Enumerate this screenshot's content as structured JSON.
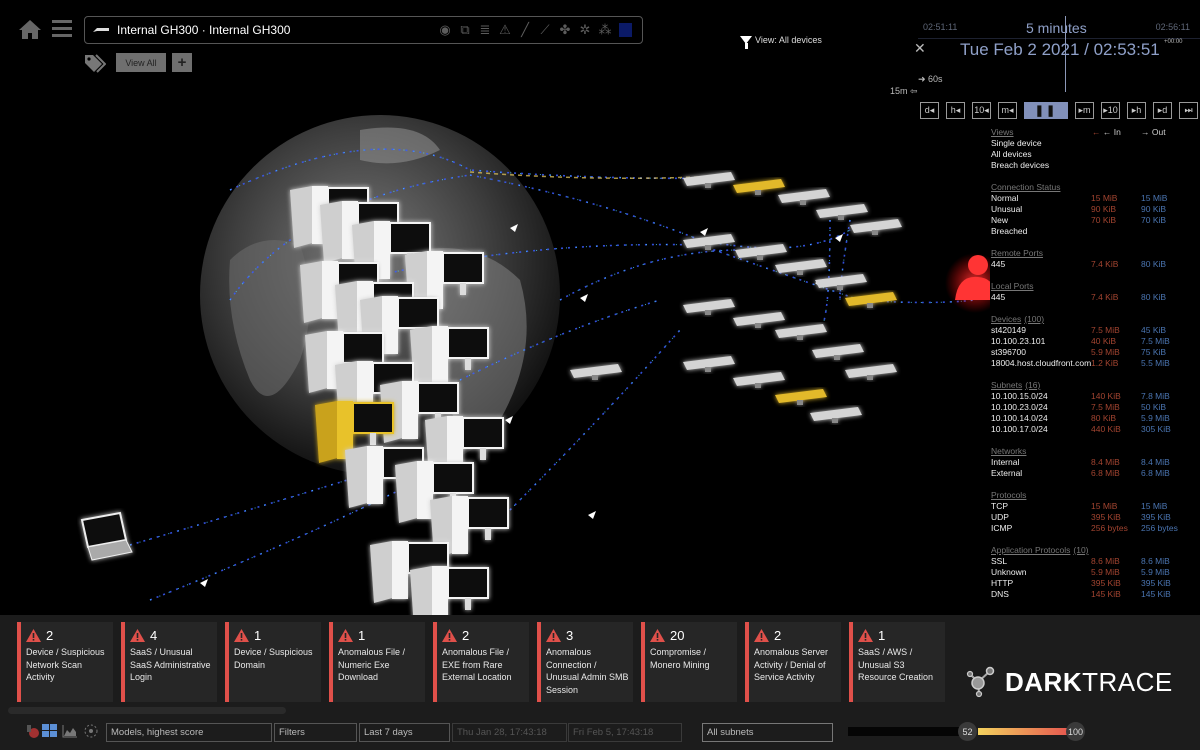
{
  "header": {
    "device_title": "Internal GH300 · Internal GH300",
    "toolbar_icons": [
      "record-icon",
      "device-icon",
      "list-icon",
      "warning-icon",
      "pen-icon",
      "chart-icon",
      "puzzle-icon",
      "network-icon",
      "cluster-icon",
      "color-square-icon"
    ],
    "view_all_label": "View All",
    "add_label": "+",
    "view_filter_label": "View: All devices"
  },
  "time": {
    "start": "02:51:11",
    "end": "02:56:11",
    "range": "5 minutes",
    "current": "Tue Feb 2 2021 / 02:53:51",
    "timezone": "+00:00",
    "step_60s": "60s",
    "step_15m": "15m",
    "controls": [
      "d◂",
      "h◂",
      "10◂",
      "m◂",
      "❚❚",
      "▸m",
      "▸10",
      "▸h",
      "▸d",
      "⏭"
    ]
  },
  "stats": {
    "in_label": "← In",
    "out_label": "→ Out",
    "views": {
      "title": "Views",
      "items": [
        "Single device",
        "All devices",
        "Breach devices"
      ]
    },
    "sections": [
      {
        "title": "Connection Status",
        "count": "",
        "rows": [
          {
            "name": "Normal",
            "in": "15 MiB",
            "out": "15 MiB"
          },
          {
            "name": "Unusual",
            "in": "90 KiB",
            "out": "90 KiB"
          },
          {
            "name": "New",
            "in": "70 KiB",
            "out": "70 KiB"
          },
          {
            "name": "Breached",
            "in": "",
            "out": ""
          }
        ]
      },
      {
        "title": "Remote Ports",
        "count": "",
        "rows": [
          {
            "name": "445",
            "in": "7.4 KiB",
            "out": "80 KiB"
          }
        ]
      },
      {
        "title": "Local Ports",
        "count": "",
        "rows": [
          {
            "name": "445",
            "in": "7.4 KiB",
            "out": "80 KiB"
          }
        ]
      },
      {
        "title": "Devices",
        "count": "(100)",
        "rows": [
          {
            "name": "st420149",
            "in": "7.5 MiB",
            "out": "45 KiB"
          },
          {
            "name": "10.100.23.101",
            "in": "40 KiB",
            "out": "7.5 MiB"
          },
          {
            "name": "st396700",
            "in": "5.9 MiB",
            "out": "75 KiB"
          },
          {
            "name": "18004.host.cloudfront.com",
            "in": "1.2 KiB",
            "out": "5.5 MiB"
          }
        ]
      },
      {
        "title": "Subnets",
        "count": "(16)",
        "rows": [
          {
            "name": "10.100.15.0/24",
            "in": "140 KiB",
            "out": "7.8 MiB"
          },
          {
            "name": "10.100.23.0/24",
            "in": "7.5 MiB",
            "out": "50 KiB"
          },
          {
            "name": "10.100.14.0/24",
            "in": "80 KiB",
            "out": "5.9 MiB"
          },
          {
            "name": "10.100.17.0/24",
            "in": "440 KiB",
            "out": "305 KiB"
          }
        ]
      },
      {
        "title": "Networks",
        "count": "",
        "rows": [
          {
            "name": "Internal",
            "in": "8.4 MiB",
            "out": "8.4 MiB"
          },
          {
            "name": "External",
            "in": "6.8 MiB",
            "out": "6.8 MiB"
          }
        ]
      },
      {
        "title": "Protocols",
        "count": "",
        "rows": [
          {
            "name": "TCP",
            "in": "15 MiB",
            "out": "15 MiB"
          },
          {
            "name": "UDP",
            "in": "395 KiB",
            "out": "395 KiB"
          },
          {
            "name": "ICMP",
            "in": "256 bytes",
            "out": "256 bytes"
          }
        ]
      },
      {
        "title": "Application Protocols",
        "count": "(10)",
        "rows": [
          {
            "name": "SSL",
            "in": "8.6 MiB",
            "out": "8.6 MiB"
          },
          {
            "name": "Unknown",
            "in": "5.9 MiB",
            "out": "5.9 MiB"
          },
          {
            "name": "HTTP",
            "in": "395 KiB",
            "out": "395 KiB"
          },
          {
            "name": "DNS",
            "in": "145 KiB",
            "out": "145 KiB"
          }
        ]
      }
    ]
  },
  "alerts": [
    {
      "count": "2",
      "text": "Device / Suspicious Network Scan Activity"
    },
    {
      "count": "4",
      "text": "SaaS / Unusual SaaS Administrative Login"
    },
    {
      "count": "1",
      "text": "Device / Suspicious Domain"
    },
    {
      "count": "1",
      "text": "Anomalous File / Numeric Exe Download"
    },
    {
      "count": "2",
      "text": "Anomalous File / EXE from Rare External Location"
    },
    {
      "count": "3",
      "text": "Anomalous Connection / Unusual Admin SMB Session"
    },
    {
      "count": "20",
      "text": "Compromise / Monero Mining"
    },
    {
      "count": "2",
      "text": "Anomalous Server Activity / Denial of Service Activity"
    },
    {
      "count": "1",
      "text": "SaaS / AWS / Unusual S3 Resource Creation"
    }
  ],
  "brand": {
    "bold": "DARK",
    "light": "TRACE"
  },
  "toolbar": {
    "sort": "Models, highest score",
    "filters": "Filters",
    "period": "Last 7 days",
    "from": "Thu Jan 28, 17:43:18",
    "to": "Fri Feb 5, 17:43:18",
    "subnets": "All subnets",
    "score_min": "52",
    "score_max": "100"
  },
  "colors": {
    "alert": "#e0504a",
    "in": "#a24430",
    "out": "#4a74b0",
    "accent": "#8fa0c8",
    "breach_highlight": "#e8c22a"
  }
}
